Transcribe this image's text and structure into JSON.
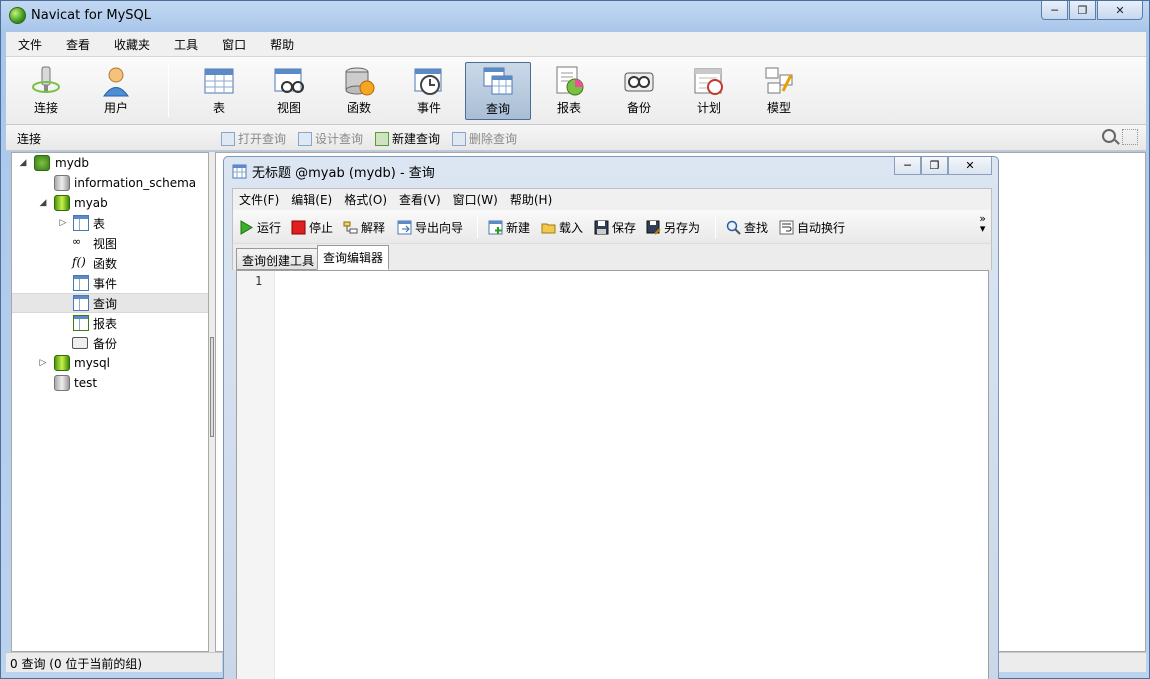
{
  "window": {
    "title": "Navicat for MySQL",
    "controls": [
      "minimize",
      "restore",
      "close"
    ]
  },
  "menubar": [
    "文件",
    "查看",
    "收藏夹",
    "工具",
    "窗口",
    "帮助"
  ],
  "toolbar": {
    "connection": "连接",
    "user": "用户",
    "objects": [
      "表",
      "视图",
      "函数",
      "事件",
      "查询",
      "报表",
      "备份",
      "计划",
      "模型"
    ],
    "active": "查询"
  },
  "subbar": {
    "left_label": "连接",
    "actions": [
      {
        "label": "打开查询",
        "enabled": false
      },
      {
        "label": "设计查询",
        "enabled": false
      },
      {
        "label": "新建查询",
        "enabled": true
      },
      {
        "label": "删除查询",
        "enabled": false
      }
    ]
  },
  "tree": {
    "connection": "mydb",
    "databases": [
      "information_schema",
      "myab",
      "mysql",
      "test"
    ],
    "myab_children": [
      "表",
      "视图",
      "函数",
      "事件",
      "查询",
      "报表",
      "备份"
    ],
    "selected": "查询"
  },
  "status": {
    "left": "0 查询 (0 位于当前的组)"
  },
  "query_window": {
    "title": "无标题 @myab (mydb) - 查询",
    "menu": [
      "文件(F)",
      "编辑(E)",
      "格式(O)",
      "查看(V)",
      "窗口(W)",
      "帮助(H)"
    ],
    "toolbar": [
      "运行",
      "停止",
      "解释",
      "导出向导",
      "新建",
      "载入",
      "保存",
      "另存为",
      "查找",
      "自动换行"
    ],
    "more": "»",
    "tabs": [
      "查询创建工具",
      "查询编辑器"
    ],
    "active_tab": "查询编辑器",
    "line_numbers": [
      "1"
    ]
  }
}
